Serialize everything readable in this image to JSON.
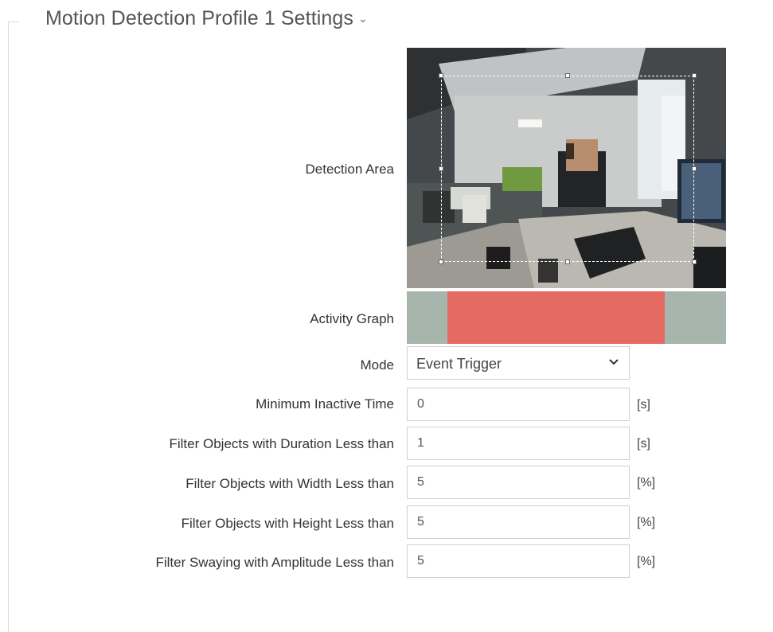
{
  "section": {
    "title": "Motion Detection Profile 1 Settings",
    "chevron": "chevron-down-icon"
  },
  "detection_area": {
    "label": "Detection Area"
  },
  "activity_graph": {
    "label": "Activity Graph",
    "colors": {
      "idle": "#a6b6ad",
      "active": "#e36b62"
    }
  },
  "mode": {
    "label": "Mode",
    "value": "Event Trigger"
  },
  "fields": [
    {
      "label": "Minimum Inactive Time",
      "value": "0",
      "unit": "[s]"
    },
    {
      "label": "Filter Objects with Duration Less than",
      "value": "1",
      "unit": "[s]"
    },
    {
      "label": "Filter Objects with Width Less than",
      "value": "5",
      "unit": "[%]"
    },
    {
      "label": "Filter Objects with Height Less than",
      "value": "5",
      "unit": "[%]"
    },
    {
      "label": "Filter Swaying with Amplitude Less than",
      "value": "5",
      "unit": "[%]"
    }
  ]
}
